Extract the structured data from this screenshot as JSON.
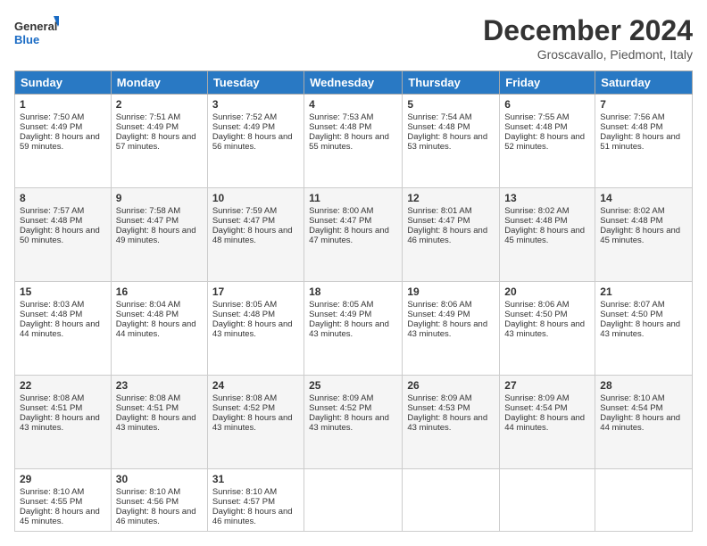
{
  "logo": {
    "line1": "General",
    "line2": "Blue"
  },
  "title": "December 2024",
  "location": "Groscavallo, Piedmont, Italy",
  "headers": [
    "Sunday",
    "Monday",
    "Tuesday",
    "Wednesday",
    "Thursday",
    "Friday",
    "Saturday"
  ],
  "weeks": [
    [
      {
        "day": "1",
        "sunrise": "7:50 AM",
        "sunset": "4:49 PM",
        "daylight": "8 hours and 59 minutes."
      },
      {
        "day": "2",
        "sunrise": "7:51 AM",
        "sunset": "4:49 PM",
        "daylight": "8 hours and 57 minutes."
      },
      {
        "day": "3",
        "sunrise": "7:52 AM",
        "sunset": "4:49 PM",
        "daylight": "8 hours and 56 minutes."
      },
      {
        "day": "4",
        "sunrise": "7:53 AM",
        "sunset": "4:48 PM",
        "daylight": "8 hours and 55 minutes."
      },
      {
        "day": "5",
        "sunrise": "7:54 AM",
        "sunset": "4:48 PM",
        "daylight": "8 hours and 53 minutes."
      },
      {
        "day": "6",
        "sunrise": "7:55 AM",
        "sunset": "4:48 PM",
        "daylight": "8 hours and 52 minutes."
      },
      {
        "day": "7",
        "sunrise": "7:56 AM",
        "sunset": "4:48 PM",
        "daylight": "8 hours and 51 minutes."
      }
    ],
    [
      {
        "day": "8",
        "sunrise": "7:57 AM",
        "sunset": "4:48 PM",
        "daylight": "8 hours and 50 minutes."
      },
      {
        "day": "9",
        "sunrise": "7:58 AM",
        "sunset": "4:47 PM",
        "daylight": "8 hours and 49 minutes."
      },
      {
        "day": "10",
        "sunrise": "7:59 AM",
        "sunset": "4:47 PM",
        "daylight": "8 hours and 48 minutes."
      },
      {
        "day": "11",
        "sunrise": "8:00 AM",
        "sunset": "4:47 PM",
        "daylight": "8 hours and 47 minutes."
      },
      {
        "day": "12",
        "sunrise": "8:01 AM",
        "sunset": "4:47 PM",
        "daylight": "8 hours and 46 minutes."
      },
      {
        "day": "13",
        "sunrise": "8:02 AM",
        "sunset": "4:48 PM",
        "daylight": "8 hours and 45 minutes."
      },
      {
        "day": "14",
        "sunrise": "8:02 AM",
        "sunset": "4:48 PM",
        "daylight": "8 hours and 45 minutes."
      }
    ],
    [
      {
        "day": "15",
        "sunrise": "8:03 AM",
        "sunset": "4:48 PM",
        "daylight": "8 hours and 44 minutes."
      },
      {
        "day": "16",
        "sunrise": "8:04 AM",
        "sunset": "4:48 PM",
        "daylight": "8 hours and 44 minutes."
      },
      {
        "day": "17",
        "sunrise": "8:05 AM",
        "sunset": "4:48 PM",
        "daylight": "8 hours and 43 minutes."
      },
      {
        "day": "18",
        "sunrise": "8:05 AM",
        "sunset": "4:49 PM",
        "daylight": "8 hours and 43 minutes."
      },
      {
        "day": "19",
        "sunrise": "8:06 AM",
        "sunset": "4:49 PM",
        "daylight": "8 hours and 43 minutes."
      },
      {
        "day": "20",
        "sunrise": "8:06 AM",
        "sunset": "4:50 PM",
        "daylight": "8 hours and 43 minutes."
      },
      {
        "day": "21",
        "sunrise": "8:07 AM",
        "sunset": "4:50 PM",
        "daylight": "8 hours and 43 minutes."
      }
    ],
    [
      {
        "day": "22",
        "sunrise": "8:08 AM",
        "sunset": "4:51 PM",
        "daylight": "8 hours and 43 minutes."
      },
      {
        "day": "23",
        "sunrise": "8:08 AM",
        "sunset": "4:51 PM",
        "daylight": "8 hours and 43 minutes."
      },
      {
        "day": "24",
        "sunrise": "8:08 AM",
        "sunset": "4:52 PM",
        "daylight": "8 hours and 43 minutes."
      },
      {
        "day": "25",
        "sunrise": "8:09 AM",
        "sunset": "4:52 PM",
        "daylight": "8 hours and 43 minutes."
      },
      {
        "day": "26",
        "sunrise": "8:09 AM",
        "sunset": "4:53 PM",
        "daylight": "8 hours and 43 minutes."
      },
      {
        "day": "27",
        "sunrise": "8:09 AM",
        "sunset": "4:54 PM",
        "daylight": "8 hours and 44 minutes."
      },
      {
        "day": "28",
        "sunrise": "8:10 AM",
        "sunset": "4:54 PM",
        "daylight": "8 hours and 44 minutes."
      }
    ],
    [
      {
        "day": "29",
        "sunrise": "8:10 AM",
        "sunset": "4:55 PM",
        "daylight": "8 hours and 45 minutes."
      },
      {
        "day": "30",
        "sunrise": "8:10 AM",
        "sunset": "4:56 PM",
        "daylight": "8 hours and 46 minutes."
      },
      {
        "day": "31",
        "sunrise": "8:10 AM",
        "sunset": "4:57 PM",
        "daylight": "8 hours and 46 minutes."
      },
      null,
      null,
      null,
      null
    ]
  ],
  "labels": {
    "sunrise_prefix": "Sunrise: ",
    "sunset_prefix": "Sunset: ",
    "daylight_prefix": "Daylight: "
  }
}
